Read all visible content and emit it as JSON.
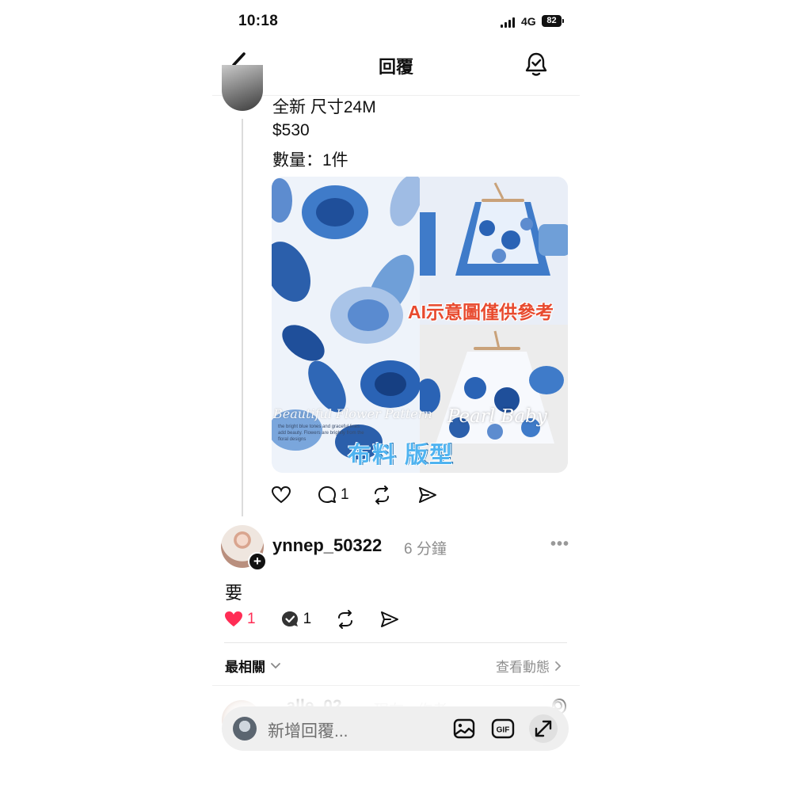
{
  "status_bar": {
    "time": "10:18",
    "network": "4G",
    "battery": "82"
  },
  "header": {
    "title": "回覆",
    "back_icon": "chevron-left-icon",
    "bell_icon": "bell-check-icon"
  },
  "post": {
    "lines": [
      "全新 尺寸24M",
      "$530",
      "數量：1件"
    ],
    "media": {
      "overlay_ai": "AI示意圖僅供參考",
      "overlay_fabric": "布料 版型",
      "overlay_brand": "Pearl Baby",
      "overlay_script": "Beautiful Flower Pattern",
      "fine_print": "the bright blue tones and graceful lines add beauty. Flowers are brightly from the floral designs"
    },
    "actions": {
      "likes": "",
      "comments": "1",
      "reposts": "",
      "shares": ""
    }
  },
  "reply": {
    "username": "ynnep_50322",
    "time": "6 分鐘",
    "text": "要",
    "likes": "1",
    "comments": "1",
    "liked_color": "#ff2d55"
  },
  "sort_bar": {
    "sort_label": "最相關",
    "activity_label": "查看動態"
  },
  "next_reply": {
    "username": "...alle_02",
    "time": "現在 · 作者"
  },
  "composer": {
    "placeholder": "新增回覆..."
  }
}
